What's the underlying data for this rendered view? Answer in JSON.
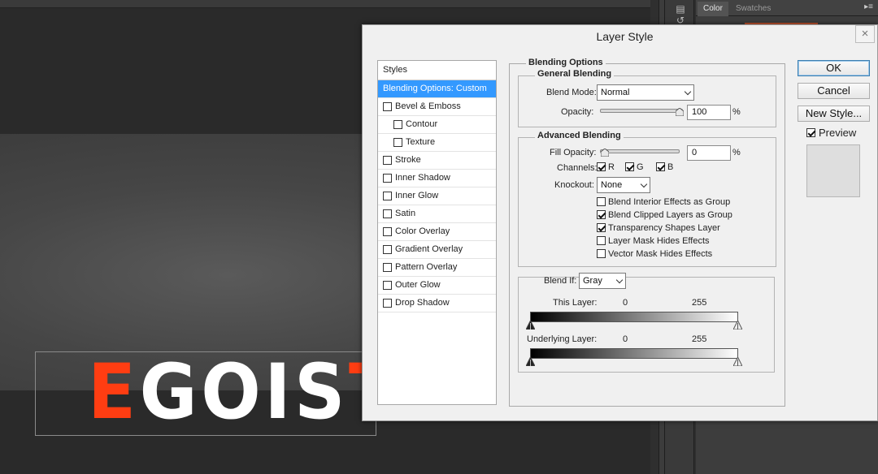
{
  "canvas": {
    "logo_text_main": "EGOIS",
    "logo_text_accent": "T",
    "logo_first_letter": "E"
  },
  "panels": {
    "tabs": [
      {
        "label": "Color",
        "active": true
      },
      {
        "label": "Swatches",
        "active": false
      }
    ],
    "menu_icon": "panel-menu-icon"
  },
  "dialog": {
    "title": "Layer Style",
    "close_glyph": "×",
    "styles_header": "Styles",
    "style_items": [
      {
        "label": "Blending Options: Custom",
        "selected": true,
        "checkbox": false,
        "sub": false
      },
      {
        "label": "Bevel & Emboss",
        "selected": false,
        "checkbox": true,
        "checked": false,
        "sub": false
      },
      {
        "label": "Contour",
        "selected": false,
        "checkbox": true,
        "checked": false,
        "sub": true
      },
      {
        "label": "Texture",
        "selected": false,
        "checkbox": true,
        "checked": false,
        "sub": true
      },
      {
        "label": "Stroke",
        "selected": false,
        "checkbox": true,
        "checked": false,
        "sub": false
      },
      {
        "label": "Inner Shadow",
        "selected": false,
        "checkbox": true,
        "checked": false,
        "sub": false
      },
      {
        "label": "Inner Glow",
        "selected": false,
        "checkbox": true,
        "checked": false,
        "sub": false
      },
      {
        "label": "Satin",
        "selected": false,
        "checkbox": true,
        "checked": false,
        "sub": false
      },
      {
        "label": "Color Overlay",
        "selected": false,
        "checkbox": true,
        "checked": false,
        "sub": false
      },
      {
        "label": "Gradient Overlay",
        "selected": false,
        "checkbox": true,
        "checked": false,
        "sub": false
      },
      {
        "label": "Pattern Overlay",
        "selected": false,
        "checkbox": true,
        "checked": false,
        "sub": false
      },
      {
        "label": "Outer Glow",
        "selected": false,
        "checkbox": true,
        "checked": false,
        "sub": false
      },
      {
        "label": "Drop Shadow",
        "selected": false,
        "checkbox": true,
        "checked": false,
        "sub": false
      }
    ],
    "blending": {
      "title": "Blending Options",
      "general_title": "General Blending",
      "blend_mode_label": "Blend Mode:",
      "blend_mode_value": "Normal",
      "opacity_label": "Opacity:",
      "opacity_value": "100",
      "opacity_unit": "%",
      "opacity_level": 1.0,
      "advanced_title": "Advanced Blending",
      "fill_opacity_label": "Fill Opacity:",
      "fill_opacity_value": "0",
      "fill_opacity_unit": "%",
      "fill_opacity_level": 0.0,
      "channels_label": "Channels:",
      "channels": [
        {
          "label": "R",
          "checked": true
        },
        {
          "label": "G",
          "checked": true
        },
        {
          "label": "B",
          "checked": true
        }
      ],
      "knockout_label": "Knockout:",
      "knockout_value": "None",
      "options": [
        {
          "label": "Blend Interior Effects as Group",
          "checked": false
        },
        {
          "label": "Blend Clipped Layers as Group",
          "checked": true
        },
        {
          "label": "Transparency Shapes Layer",
          "checked": true
        },
        {
          "label": "Layer Mask Hides Effects",
          "checked": false
        },
        {
          "label": "Vector Mask Hides Effects",
          "checked": false
        }
      ],
      "blend_if_label": "Blend If:",
      "blend_if_value": "Gray",
      "this_layer_label": "This Layer:",
      "this_layer_min": "0",
      "this_layer_max": "255",
      "underlying_label": "Underlying Layer:",
      "underlying_min": "0",
      "underlying_max": "255"
    },
    "buttons": {
      "ok": "OK",
      "cancel": "Cancel",
      "new_style": "New Style...",
      "preview_label": "Preview",
      "preview_checked": true
    }
  }
}
